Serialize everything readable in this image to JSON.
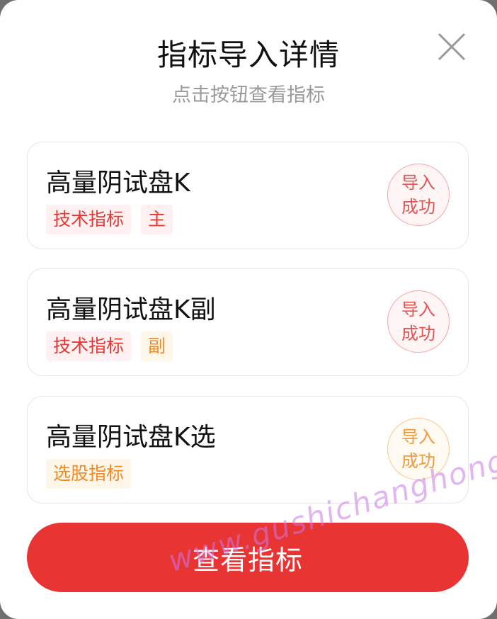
{
  "dialog": {
    "title": "指标导入详情",
    "subtitle": "点击按钮查看指标",
    "close_icon": "close-icon"
  },
  "cards": [
    {
      "name": "高量阴试盘K",
      "tags": [
        "技术指标",
        "主"
      ],
      "tag_colors": [
        "red",
        "red"
      ],
      "status_line1": "导入",
      "status_line2": "成功",
      "status_color": "red"
    },
    {
      "name": "高量阴试盘K副",
      "tags": [
        "技术指标",
        "副"
      ],
      "tag_colors": [
        "red",
        "orange"
      ],
      "status_line1": "导入",
      "status_line2": "成功",
      "status_color": "red"
    },
    {
      "name": "高量阴试盘K选",
      "tags": [
        "选股指标"
      ],
      "tag_colors": [
        "orange"
      ],
      "status_line1": "导入",
      "status_line2": "成功",
      "status_color": "orange"
    }
  ],
  "action": {
    "label": "查看指标"
  },
  "watermark": "www.gushichanghong.com",
  "colors": {
    "accent": "#e93434",
    "tag_red": "#e53935",
    "tag_orange": "#f08a24"
  }
}
